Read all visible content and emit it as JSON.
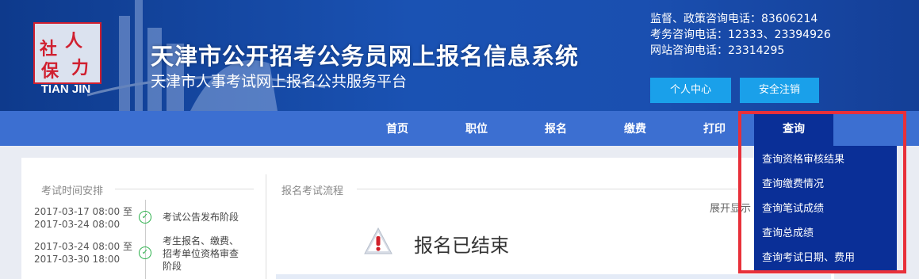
{
  "header": {
    "title": "天津市公开招考公务员网上报名信息系统",
    "subtitle": "天津市人事考试网上报名公共服务平台",
    "logo_chars": [
      "人",
      "社",
      "力",
      "保"
    ],
    "logo_text": "TIAN JIN",
    "phones": [
      "监督、政策咨询电话：83606214",
      "考务咨询电话：12333、23394926",
      "网站咨询电话：23314295"
    ],
    "buttons": {
      "personal": "个人中心",
      "logout": "安全注销"
    }
  },
  "nav": {
    "items": [
      {
        "label": "首页"
      },
      {
        "label": "职位"
      },
      {
        "label": "报名"
      },
      {
        "label": "缴费"
      },
      {
        "label": "打印"
      },
      {
        "label": "查询"
      }
    ],
    "active": "查询"
  },
  "dropdown": {
    "items": [
      {
        "label": "查询资格审核结果"
      },
      {
        "label": "查询缴费情况"
      },
      {
        "label": "查询笔试成绩"
      },
      {
        "label": "查询总成绩"
      },
      {
        "label": "查询考试日期、费用"
      }
    ]
  },
  "schedule": {
    "title": "考试时间安排",
    "items": [
      {
        "dates": [
          "2017-03-17 08:00 至",
          "2017-03-24 08:00"
        ],
        "name": "考试公告发布阶段"
      },
      {
        "dates": [
          "2017-03-24 08:00 至",
          "2017-03-30 18:00"
        ],
        "name": "考生报名、缴费、招考单位资格审查阶段"
      }
    ]
  },
  "flow": {
    "title": "报名考试流程",
    "expand": "展开显示",
    "status": "报名已结束"
  },
  "colors": {
    "highlight": "#e8303a",
    "nav": "#3c6fd1",
    "active": "#0a2f97",
    "button": "#1aa0ea"
  }
}
